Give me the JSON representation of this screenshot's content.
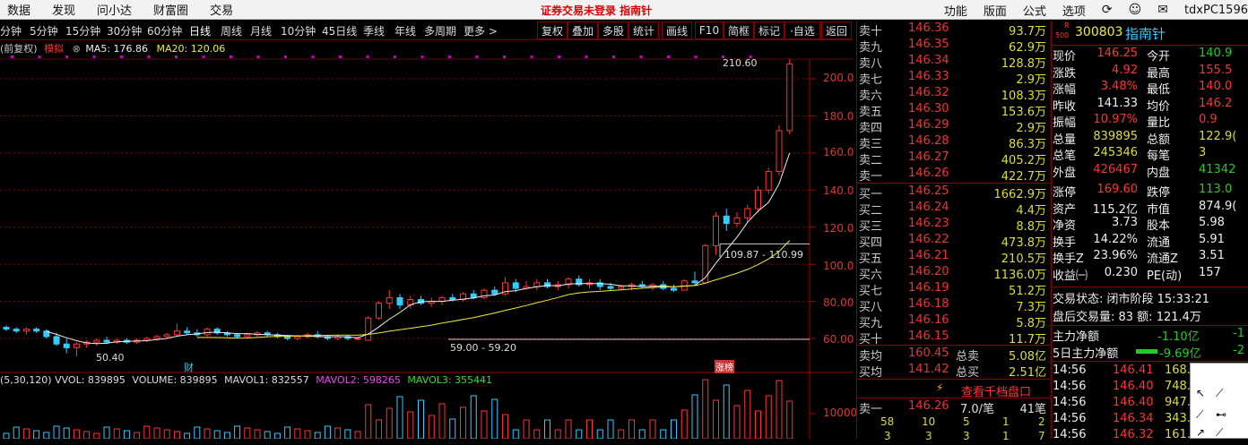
{
  "menubar": {
    "items": [
      "数据",
      "发现",
      "问小达",
      "财富圈",
      "交易"
    ],
    "notice": "证券交易未登录  指南针",
    "right_items": [
      "功能",
      "版面",
      "公式",
      "选项"
    ],
    "user": "tdxPC1596"
  },
  "toolbar": {
    "periods": [
      "分钟",
      "5分钟",
      "15分钟",
      "30分钟",
      "60分钟",
      "日线",
      "周线",
      "月线",
      "10分钟",
      "45日线",
      "季线",
      "年线",
      "多周期",
      "更多 >"
    ],
    "active_period": "日线",
    "buttons": [
      "复权",
      "叠加",
      "多股",
      "统计",
      "画线",
      "F10",
      "简框",
      "标记",
      "·自选",
      "返回"
    ]
  },
  "ma_line": {
    "left": "(前复权)",
    "mode": "模拟",
    "ma5": "MA5: 176.86",
    "ma20": "MA20: 120.06"
  },
  "annotations": {
    "high": "210.60",
    "range_up": "109.87 - 110.99",
    "range_mid": "59.00 - 59.20",
    "low": "50.40",
    "marker_cai": "财",
    "marker_zhang": "涨榜"
  },
  "y_axis": [
    "200.0",
    "180.0",
    "160.0",
    "140.0",
    "120.0",
    "100.0",
    "80.00",
    "60.00"
  ],
  "vol_axis": [
    "10000"
  ],
  "vol_line": {
    "params": "(5,30,120) VVOL: 839895",
    "volume": "VOLUME: 839895",
    "mavol1": "MAVOL1: 832557",
    "mavol2": "MAVOL2: 598265",
    "mavol3": "MAVOL3: 355441"
  },
  "chart_data": {
    "type": "candlestick",
    "ylim": [
      50,
      215
    ],
    "candles": [
      [
        66,
        67,
        64,
        65
      ],
      [
        65,
        66,
        63,
        64
      ],
      [
        64,
        66,
        62,
        65
      ],
      [
        65,
        66,
        63,
        64
      ],
      [
        64,
        65,
        60,
        61
      ],
      [
        61,
        63,
        56,
        57
      ],
      [
        57,
        60,
        52,
        55
      ],
      [
        55,
        58,
        50.4,
        57
      ],
      [
        57,
        59,
        55,
        58
      ],
      [
        58,
        60,
        56,
        59
      ],
      [
        59,
        61,
        57,
        58
      ],
      [
        58,
        60,
        57,
        59
      ],
      [
        59,
        60,
        57,
        58
      ],
      [
        58,
        60,
        57,
        59
      ],
      [
        59,
        61,
        58,
        60
      ],
      [
        60,
        62,
        59,
        61
      ],
      [
        61,
        63,
        60,
        62
      ],
      [
        62,
        68,
        61,
        64
      ],
      [
        64,
        66,
        62,
        63
      ],
      [
        63,
        65,
        61,
        62
      ],
      [
        62,
        66,
        61,
        65
      ],
      [
        65,
        66,
        62,
        63
      ],
      [
        63,
        64,
        61,
        62
      ],
      [
        62,
        63,
        60,
        61
      ],
      [
        61,
        63,
        60,
        62
      ],
      [
        62,
        64,
        61,
        63
      ],
      [
        63,
        64,
        61,
        62
      ],
      [
        62,
        63,
        60,
        61
      ],
      [
        61,
        62,
        59,
        60
      ],
      [
        60,
        62,
        59,
        61
      ],
      [
        61,
        63,
        60,
        62
      ],
      [
        62,
        64,
        60,
        61
      ],
      [
        61,
        62,
        59,
        60
      ],
      [
        60,
        62,
        59,
        61
      ],
      [
        61,
        62,
        59,
        60
      ],
      [
        60,
        61,
        59,
        60
      ],
      [
        59,
        72,
        59,
        71
      ],
      [
        71,
        80,
        70,
        79
      ],
      [
        79,
        86,
        76,
        82
      ],
      [
        82,
        84,
        76,
        78
      ],
      [
        78,
        83,
        76,
        81
      ],
      [
        81,
        83,
        78,
        79
      ],
      [
        79,
        82,
        77,
        80
      ],
      [
        80,
        83,
        78,
        82
      ],
      [
        82,
        84,
        80,
        81
      ],
      [
        81,
        85,
        80,
        84
      ],
      [
        84,
        86,
        81,
        82
      ],
      [
        82,
        87,
        81,
        86
      ],
      [
        86,
        88,
        83,
        84
      ],
      [
        84,
        93,
        83,
        90
      ],
      [
        90,
        92,
        85,
        87
      ],
      [
        87,
        91,
        86,
        88
      ],
      [
        88,
        92,
        86,
        90
      ],
      [
        90,
        92,
        87,
        88
      ],
      [
        88,
        91,
        86,
        89
      ],
      [
        89,
        93,
        87,
        92
      ],
      [
        92,
        94,
        88,
        89
      ],
      [
        89,
        92,
        87,
        90
      ],
      [
        90,
        92,
        86,
        88
      ],
      [
        88,
        90,
        86,
        87
      ],
      [
        87,
        89,
        86,
        88
      ],
      [
        88,
        90,
        86,
        89
      ],
      [
        89,
        91,
        87,
        88
      ],
      [
        88,
        90,
        86,
        89
      ],
      [
        89,
        91,
        86,
        87
      ],
      [
        87,
        89,
        85,
        86
      ],
      [
        86,
        92,
        86,
        91
      ],
      [
        91,
        96,
        89,
        90
      ],
      [
        90,
        111,
        90,
        110
      ],
      [
        110,
        128,
        105,
        126
      ],
      [
        126,
        130,
        118,
        122
      ],
      [
        122,
        128,
        120,
        125
      ],
      [
        125,
        132,
        123,
        130
      ],
      [
        130,
        142,
        128,
        140
      ],
      [
        140,
        152,
        138,
        150
      ],
      [
        150,
        175,
        148,
        172
      ],
      [
        172,
        210.6,
        170,
        208
      ]
    ]
  },
  "orderbook": {
    "sells": [
      [
        "卖十",
        "146.36",
        "93.7万"
      ],
      [
        "卖九",
        "146.35",
        "62.9万"
      ],
      [
        "卖八",
        "146.34",
        "128.8万"
      ],
      [
        "卖七",
        "146.33",
        "2.9万"
      ],
      [
        "卖六",
        "146.32",
        "108.3万"
      ],
      [
        "卖五",
        "146.30",
        "153.6万"
      ],
      [
        "卖四",
        "146.29",
        "2.9万"
      ],
      [
        "卖三",
        "146.28",
        "86.3万"
      ],
      [
        "卖二",
        "146.27",
        "405.2万"
      ],
      [
        "卖一",
        "146.26",
        "422.7万"
      ]
    ],
    "buys": [
      [
        "买一",
        "146.25",
        "1662.9万"
      ],
      [
        "买二",
        "146.24",
        "4.4万"
      ],
      [
        "买三",
        "146.23",
        "8.8万"
      ],
      [
        "买四",
        "146.22",
        "473.8万"
      ],
      [
        "买五",
        "146.21",
        "210.5万"
      ],
      [
        "买六",
        "146.20",
        "1136.0万"
      ],
      [
        "买七",
        "146.19",
        "51.2万"
      ],
      [
        "买八",
        "146.18",
        "7.3万"
      ],
      [
        "买九",
        "146.16",
        "5.8万"
      ],
      [
        "买十",
        "146.15",
        "11.7万"
      ]
    ],
    "avg": [
      [
        "卖均",
        "160.45",
        "总卖",
        "5.08亿"
      ],
      [
        "买均",
        "141.42",
        "总买",
        "2.51亿"
      ]
    ],
    "detail_link": "查看千档盘口",
    "sell1": [
      "卖一",
      "146.26",
      "7.0/笔",
      "41笔"
    ],
    "queue1": [
      "58",
      "10",
      "5",
      "1",
      "2"
    ],
    "queue2": [
      "3",
      "3",
      "3",
      "1",
      "7"
    ]
  },
  "quote": {
    "code": "300803",
    "name": "指南针",
    "badge_top": "R",
    "badge_bottom": "500",
    "rows": [
      [
        "现价",
        "146.25",
        "今开",
        "140.9"
      ],
      [
        "涨跌",
        "4.92",
        "最高",
        "155.5"
      ],
      [
        "涨幅",
        "3.48%",
        "最低",
        "140.0"
      ],
      [
        "昨收",
        "141.33",
        "均价",
        "146.2"
      ],
      [
        "振幅",
        "10.97%",
        "量比",
        "0.9"
      ],
      [
        "总量",
        "839895",
        "总额",
        "122.9("
      ],
      [
        "总笔",
        "245346",
        "每笔",
        "3"
      ],
      [
        "外盘",
        "426467",
        "内盘",
        "41342"
      ],
      [
        "涨停",
        "169.60",
        "跌停",
        "113.0"
      ],
      [
        "资产",
        "115.2亿",
        "市值",
        "874.9("
      ],
      [
        "净资",
        "3.73",
        "股本",
        "5.98"
      ],
      [
        "换手",
        "14.22%",
        "流通",
        "5.91"
      ],
      [
        "换手Z",
        "23.96%",
        "流通Z",
        "3.51"
      ],
      [
        "收益㈠",
        "0.230",
        "PE(动)",
        "157"
      ]
    ],
    "trade_status": "交易状态: 闭市阶段 15:33:21",
    "after_hours": "盘后交易量: 83  额: 121.4万",
    "flow": [
      [
        "主力净额",
        "-1.10亿",
        "-1"
      ],
      [
        "5日主力净额",
        "-9.69亿",
        "-2"
      ]
    ],
    "ticks": [
      [
        "14:56",
        "146.41",
        "168."
      ],
      [
        "14:56",
        "146.40",
        "748."
      ],
      [
        "14:56",
        "146.40",
        "947."
      ],
      [
        "14:56",
        "146.34",
        "343."
      ],
      [
        "14:56",
        "146.32",
        "161."
      ]
    ]
  }
}
